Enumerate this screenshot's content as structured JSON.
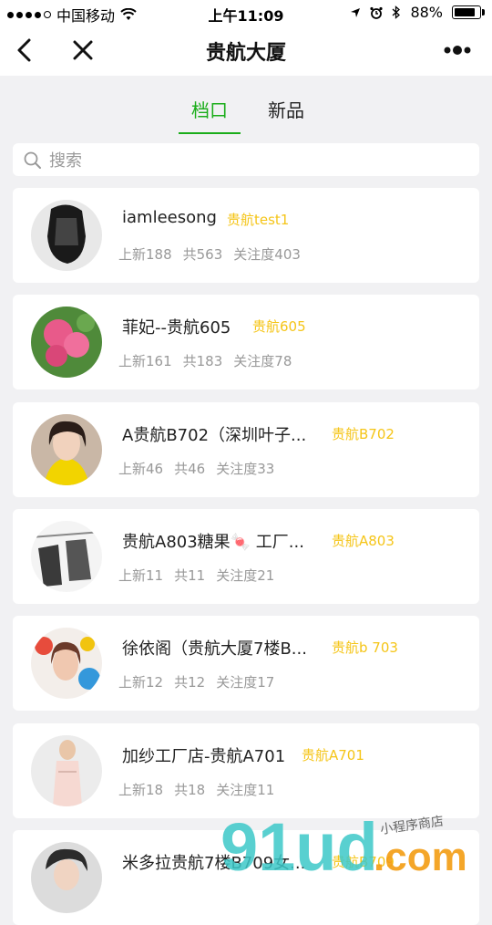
{
  "status_bar": {
    "carrier": "中国移动",
    "time": "上午11:09",
    "battery": "88%"
  },
  "nav": {
    "title": "贵航大厦"
  },
  "tabs": [
    {
      "label": "档口",
      "active": true
    },
    {
      "label": "新品",
      "active": false
    }
  ],
  "search": {
    "placeholder": "搜索"
  },
  "stores": [
    {
      "name": "iamleesong",
      "tag": "贵航test1",
      "new": "上新188",
      "total": "共563",
      "follow": "关注度403"
    },
    {
      "name": "菲妃--贵航605",
      "tag": "贵航605",
      "new": "上新161",
      "total": "共183",
      "follow": "关注度78"
    },
    {
      "name": "A贵航B702（深圳叶子...",
      "tag": "贵航B702",
      "new": "上新46",
      "total": "共46",
      "follow": "关注度33"
    },
    {
      "name": "贵航A803糖果🍬 工厂...",
      "tag": "贵航A803",
      "new": "上新11",
      "total": "共11",
      "follow": "关注度21"
    },
    {
      "name": "徐依阁（贵航大厦7楼B...",
      "tag": "贵航b 703",
      "new": "上新12",
      "total": "共12",
      "follow": "关注度17"
    },
    {
      "name": "加纱工厂店-贵航A701",
      "tag": "贵航A701",
      "new": "上新18",
      "total": "共18",
      "follow": "关注度11"
    },
    {
      "name": "米多拉贵航7楼B709女...",
      "tag": "贵航B709",
      "new": "",
      "total": "",
      "follow": ""
    }
  ],
  "watermark": {
    "brand": "91ud",
    "suffix": ".com",
    "caption": "小程序商店"
  },
  "colors": {
    "accent": "#1aad19",
    "tag": "#f5c518"
  }
}
